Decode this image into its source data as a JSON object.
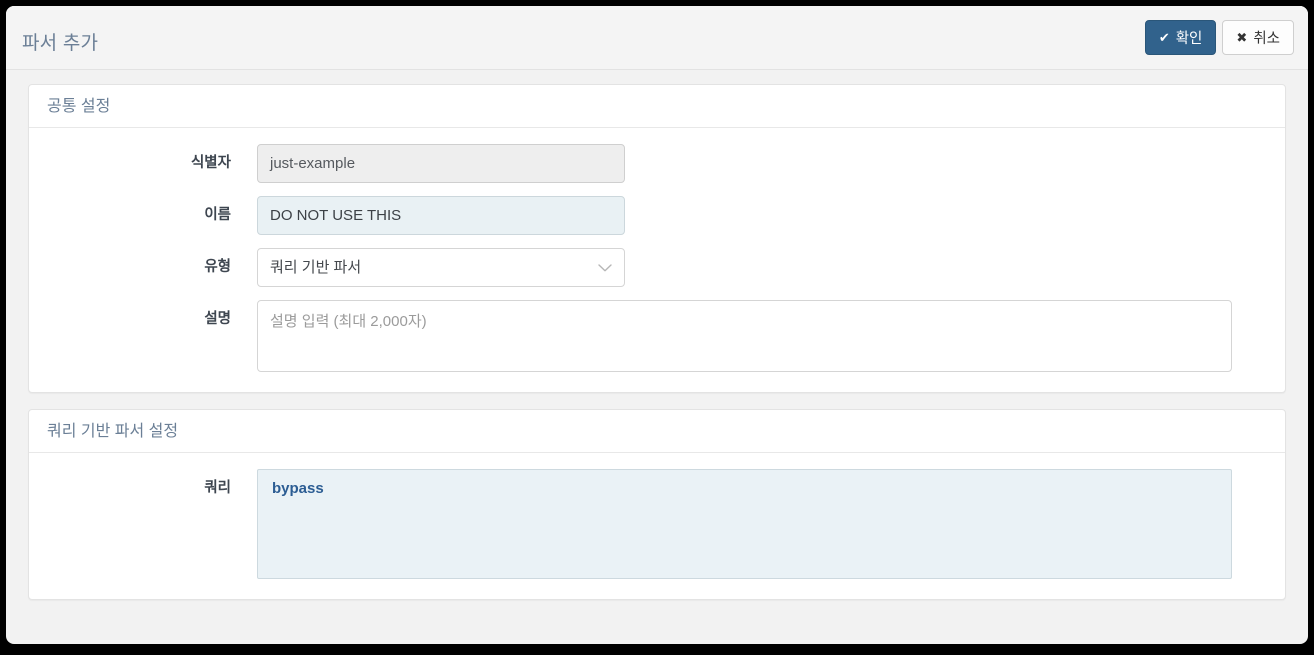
{
  "dialog": {
    "title": "파서 추가",
    "actions": {
      "confirm": {
        "label": "확인",
        "icon": "check-icon",
        "glyph": "✔",
        "color": "#31628c"
      },
      "cancel": {
        "label": "취소",
        "icon": "close-icon",
        "glyph": "✖",
        "color": "#fdfdfd"
      }
    }
  },
  "panels": [
    {
      "heading": "공통 설정",
      "fields": [
        {
          "label": "식별자",
          "value": "just-example",
          "placeholder": "",
          "state": "disabled",
          "control": "text"
        },
        {
          "label": "이름",
          "value": "DO NOT USE THIS",
          "placeholder": "",
          "state": "filled",
          "control": "text"
        },
        {
          "label": "유형",
          "value": "쿼리 기반 파서",
          "placeholder": "",
          "state": "default",
          "control": "select",
          "chevron_icon": "chevron-down-icon"
        },
        {
          "label": "설명",
          "value": "",
          "placeholder": "설명 입력 (최대 2,000자)",
          "state": "default",
          "control": "textarea"
        }
      ]
    },
    {
      "heading": "쿼리 기반 파서 설정",
      "fields": [
        {
          "label": "쿼리",
          "value": "bypass",
          "placeholder": "",
          "state": "code",
          "control": "code",
          "token_color": "#2c5d93"
        }
      ]
    }
  ]
}
